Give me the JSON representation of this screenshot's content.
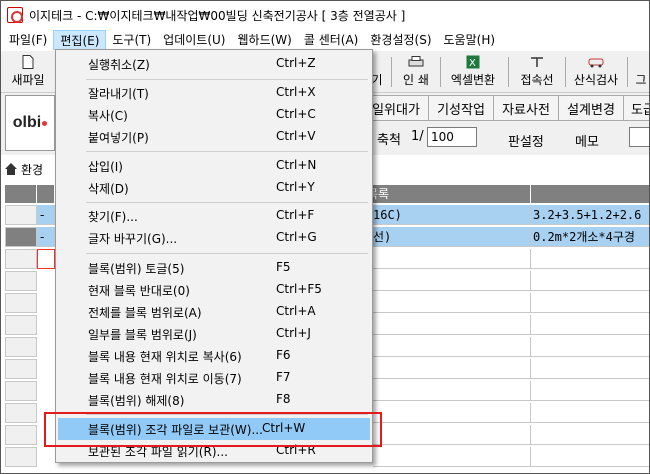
{
  "window": {
    "title": "이지테크 - C:₩이지테크₩내작업₩00빌딩 신축전기공사 [ 3층 전열공사 ]"
  },
  "menubar": [
    {
      "label": "파일(F)"
    },
    {
      "label": "편집(E)"
    },
    {
      "label": "도구(T)"
    },
    {
      "label": "업데이트(U)"
    },
    {
      "label": "웹하드(W)"
    },
    {
      "label": "콜 센터(A)"
    },
    {
      "label": "환경설정(S)"
    },
    {
      "label": "도움말(H)"
    }
  ],
  "toolbar": {
    "new_file": "새파일",
    "partial_label": "기",
    "print": "인 쇄",
    "excel_convert": "엑셀변환",
    "connection_line": "접속선",
    "inspection": "산식검사",
    "last_partial": "그"
  },
  "logo": {
    "text": "olbi"
  },
  "tabs": [
    "일위대가",
    "기성작업",
    "자료사전",
    "설계변경",
    "도급"
  ],
  "scale": {
    "label": "축척",
    "ratio_prefix": "1/",
    "value": "100"
  },
  "plate_setting": "판설정",
  "memo": "메모",
  "path_label": "환경",
  "grid": {
    "header_partial": "목록",
    "rows": [
      {
        "left": "16C)",
        "right": "3.2+3.5+1.2+2.6"
      },
      {
        "left": "선)",
        "right": "0.2m*2개소*4구경"
      }
    ],
    "row_prefix": "-"
  },
  "edit_menu": {
    "items": [
      {
        "label": "실행취소(Z)",
        "shortcut": "Ctrl+Z"
      },
      {
        "label": "잘라내기(T)",
        "shortcut": "Ctrl+X"
      },
      {
        "label": "복사(C)",
        "shortcut": "Ctrl+C"
      },
      {
        "label": "붙여넣기(P)",
        "shortcut": "Ctrl+V"
      },
      {
        "label": "삽입(I)",
        "shortcut": "Ctrl+N"
      },
      {
        "label": "삭제(D)",
        "shortcut": "Ctrl+Y"
      },
      {
        "label": "찾기(F)...",
        "shortcut": "Ctrl+F"
      },
      {
        "label": "글자 바꾸기(G)...",
        "shortcut": "Ctrl+G"
      },
      {
        "label": "블록(범위) 토글(5)",
        "shortcut": "F5"
      },
      {
        "label": "현재 블록 반대로(0)",
        "shortcut": "Ctrl+F5"
      },
      {
        "label": "전체를 블록 범위로(A)",
        "shortcut": "Ctrl+A"
      },
      {
        "label": "일부를 블록 범위로(J)",
        "shortcut": "Ctrl+J"
      },
      {
        "label": "블록 내용 현재 위치로 복사(6)",
        "shortcut": "F6"
      },
      {
        "label": "블록 내용 현재 위치로 이동(7)",
        "shortcut": "F7"
      },
      {
        "label": "블록(범위) 해제(8)",
        "shortcut": "F8"
      },
      {
        "label": "블록(범위) 조각 파일로 보관(W)...",
        "shortcut": "Ctrl+W"
      },
      {
        "label": "보관된 조각 파일 읽기(R)...",
        "shortcut": "Ctrl+R"
      }
    ]
  },
  "colors": {
    "highlight": "#91c9f7",
    "annotation_box": "#e21c1c",
    "active_menu": "#cce8ff"
  }
}
